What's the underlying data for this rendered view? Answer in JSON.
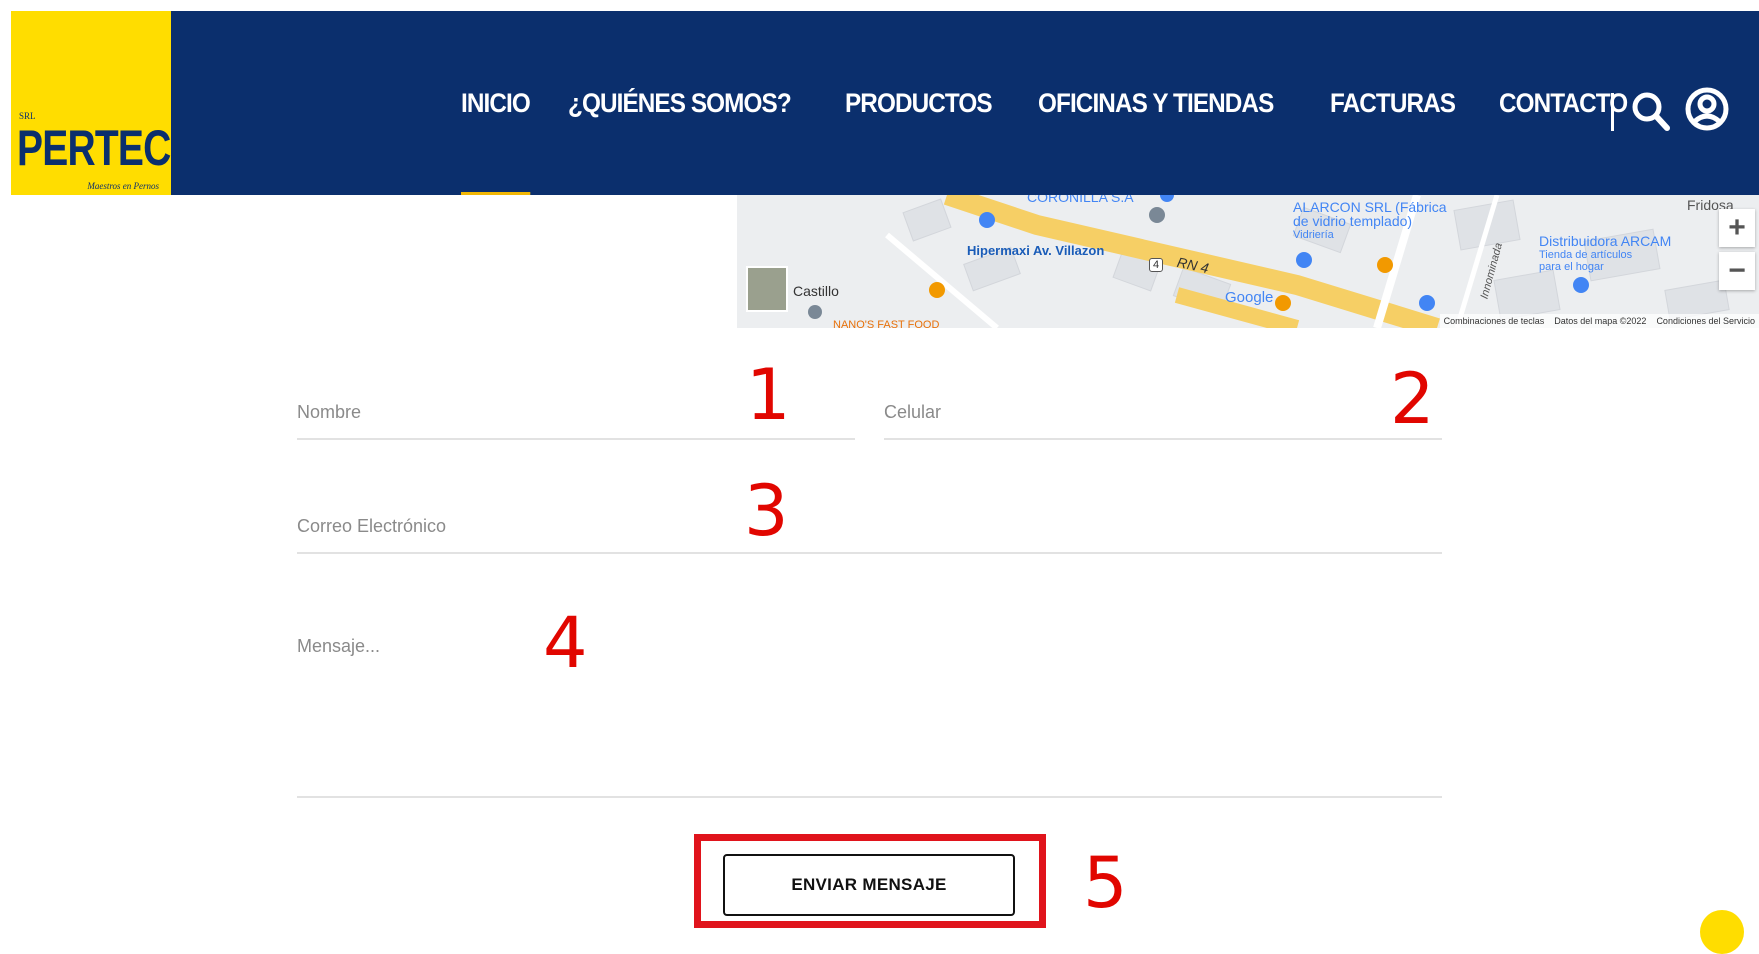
{
  "brand": {
    "name": "PERTEC",
    "prefix": "SRL",
    "tagline": "Maestros en Pernos"
  },
  "nav": {
    "items": [
      {
        "label": "INICIO",
        "active": true
      },
      {
        "label": "¿QUIÉNES SOMOS?"
      },
      {
        "label": "PRODUCTOS"
      },
      {
        "label": "OFICINAS Y TIENDAS"
      },
      {
        "label": "FACTURAS"
      },
      {
        "label": "CONTACTO"
      }
    ],
    "separator": "|",
    "icons": [
      "search-icon",
      "user-icon"
    ]
  },
  "map": {
    "labels": {
      "coronilla": "CORONILLA S.A",
      "alarcon": "ALARCON SRL (Fábrica",
      "alarcon2": "de vidrio templado)",
      "vidrieria": "Vidriería",
      "hipermaxi": "Hipermaxi Av. Villazon",
      "road": "RN 4",
      "road_shield": "4",
      "castillo": "Castillo",
      "nanos": "NANO'S FAST FOOD",
      "distribuidora": "Distribuidora ARCAM",
      "dist_sub1": "Tienda de artículos",
      "dist_sub2": "para el hogar",
      "fridosa": "Fridosa",
      "google": "Google",
      "innominada": "Innominada"
    },
    "zoom_in": "+",
    "zoom_out": "−",
    "attribution": [
      "Combinaciones de teclas",
      "Datos del mapa ©2022",
      "Condiciones del Servicio"
    ]
  },
  "form": {
    "nombre_placeholder": "Nombre",
    "celular_placeholder": "Celular",
    "correo_placeholder": "Correo Electrónico",
    "mensaje_placeholder": "Mensaje...",
    "submit_label": "ENVIAR MENSAJE"
  },
  "annotations": [
    "1",
    "2",
    "3",
    "4",
    "5"
  ],
  "colors": {
    "header_bg": "#0b2f6d",
    "logo_bg": "#ffdd00",
    "annotation": "#e10600",
    "active_underline": "#f2b705"
  }
}
